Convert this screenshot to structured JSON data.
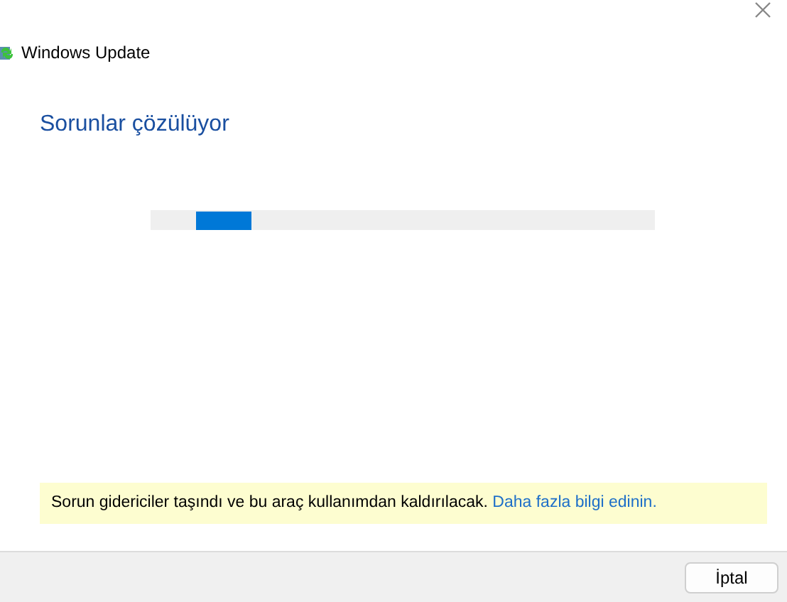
{
  "window": {
    "title": "Windows Update"
  },
  "heading": "Sorunlar çözülüyor",
  "progress": {
    "indeterminate": true
  },
  "notice": {
    "text": "Sorun gidericiler taşındı ve bu araç kullanımdan kaldırılacak.",
    "link": "Daha fazla bilgi edinin."
  },
  "buttons": [
    "İptal"
  ]
}
